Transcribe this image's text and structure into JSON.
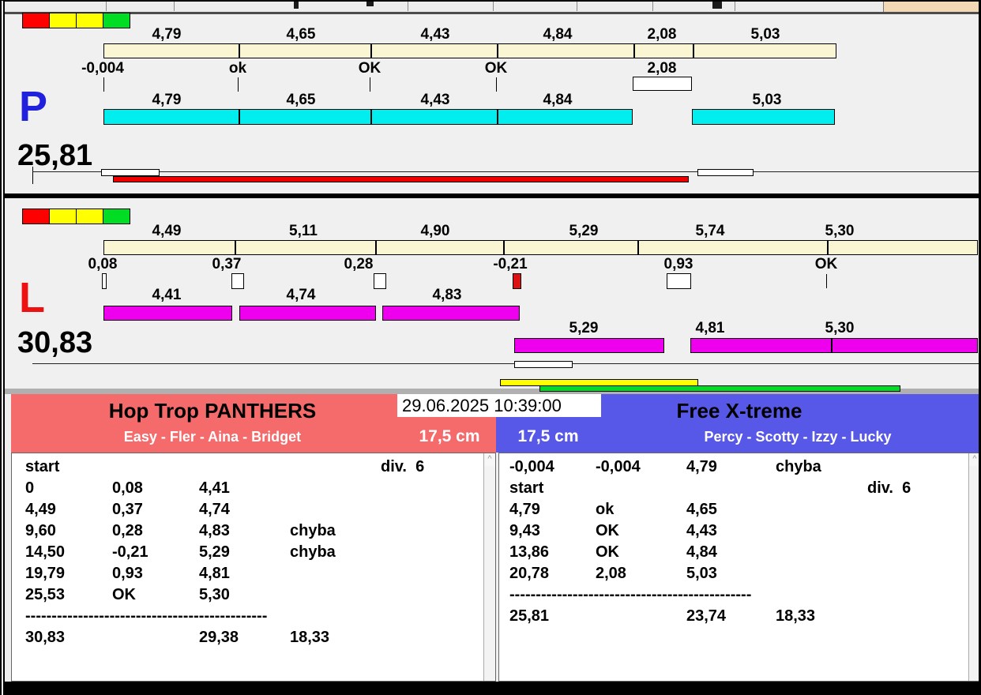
{
  "palette": {
    "background": "#f0f0f0",
    "split_bar": "#faf5d2",
    "lane_p_bar": "#00eeee",
    "lane_l_bar": "#ee00ee",
    "lane_p_letter": "#2020dd",
    "lane_l_letter": "#ee1111",
    "progress_red": "#ee0000",
    "progress_yellow": "#ffff00",
    "progress_green": "#00dd22",
    "team_left_header": "#f56a6a",
    "team_right_header": "#5858e8",
    "traffic_lights": [
      "#ff0000",
      "#ffff00",
      "#ffff00",
      "#00dd22"
    ]
  },
  "icons": {
    "scroll_up": "^"
  },
  "header": {
    "timestamp": "29.06.2025 10:39:00"
  },
  "lanes": {
    "p": {
      "label": "P",
      "total": "25,81",
      "splits": [
        "4,79",
        "4,65",
        "4,43",
        "4,84",
        "2,08",
        "5,03"
      ],
      "statuses": [
        "-0,004",
        "ok",
        "OK",
        "OK",
        "2,08"
      ],
      "dog_times": [
        "4,79",
        "4,65",
        "4,43",
        "4,84",
        "5,03"
      ]
    },
    "l": {
      "label": "L",
      "total": "30,83",
      "splits": [
        "4,49",
        "5,11",
        "4,90",
        "5,29",
        "5,74",
        "5,30"
      ],
      "statuses": [
        "0,08",
        "0,37",
        "0,28",
        "-0,21",
        "0,93",
        "OK"
      ],
      "dog_times_row1": [
        "4,41",
        "4,74",
        "4,83"
      ],
      "dog_times_row2": [
        "5,29",
        "4,81",
        "5,30"
      ]
    }
  },
  "teams": {
    "left": {
      "name": "Hop Trop PANTHERS",
      "dogs": "Easy - Fler - Aina - Bridget",
      "height": "17,5 cm",
      "start_label": "start",
      "division": "div.  6",
      "rows": [
        [
          "0",
          "0,08",
          "4,41",
          ""
        ],
        [
          "4,49",
          "0,37",
          "4,74",
          ""
        ],
        [
          "9,60",
          "0,28",
          "4,83",
          "chyba"
        ],
        [
          "14,50",
          "-0,21",
          "5,29",
          "chyba"
        ],
        [
          "19,79",
          "0,93",
          "4,81",
          ""
        ],
        [
          "25,53",
          "OK",
          "5,30",
          ""
        ]
      ],
      "separator": "----------------------------------------------",
      "totals": [
        "30,83",
        "29,38",
        "18,33"
      ]
    },
    "right": {
      "name": "Free X-treme",
      "dogs": "Percy - Scotty - Izzy - Lucky",
      "height": "17,5 cm",
      "start_label": "start",
      "division": "div.  6",
      "pre_row": [
        "-0,004",
        "-0,004",
        "4,79",
        "chyba"
      ],
      "rows": [
        [
          "4,79",
          "ok",
          "4,65",
          ""
        ],
        [
          "9,43",
          "OK",
          "4,43",
          ""
        ],
        [
          "13,86",
          "OK",
          "4,84",
          ""
        ],
        [
          "20,78",
          "2,08",
          "5,03",
          ""
        ]
      ],
      "separator": "----------------------------------------------",
      "totals": [
        "25,81",
        "23,74",
        "18,33"
      ]
    }
  }
}
